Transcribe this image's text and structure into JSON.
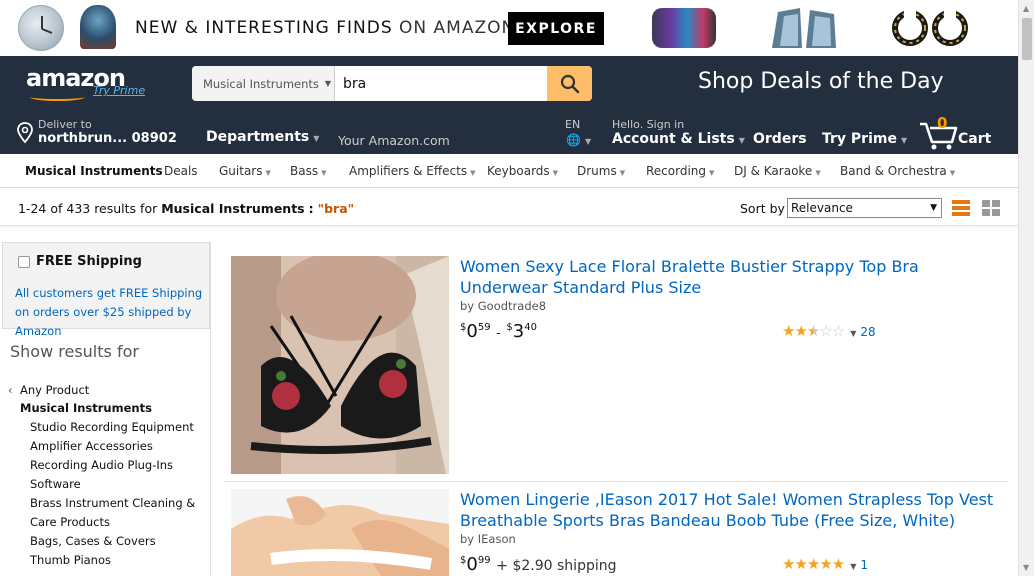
{
  "promo": {
    "headline_bold": "NEW & INTERESTING FINDS",
    "headline_light": "ON AMAZON",
    "cta": "EXPLORE"
  },
  "header": {
    "logo": "amazon",
    "try_prime_logo": "Try Prime",
    "search": {
      "category": "Musical Instruments",
      "query": "bra"
    },
    "shop_deals": "Shop Deals of the Day",
    "deliver_to_label": "Deliver to",
    "deliver_to_location": "northbrun... 08902",
    "departments": "Departments",
    "your_amazon": "Your Amazon.com",
    "language": "EN",
    "hello_signin": "Hello. Sign in",
    "account_lists": "Account & Lists",
    "orders": "Orders",
    "try_prime": "Try Prime",
    "cart_count": "0",
    "cart_label": "Cart"
  },
  "subnav": {
    "items": [
      {
        "label": "Musical Instruments",
        "active": true
      },
      {
        "label": "Deals"
      },
      {
        "label": "Guitars"
      },
      {
        "label": "Bass"
      },
      {
        "label": "Amplifiers & Effects"
      },
      {
        "label": "Keyboards"
      },
      {
        "label": "Drums"
      },
      {
        "label": "Recording"
      },
      {
        "label": "DJ & Karaoke"
      },
      {
        "label": "Band & Orchestra"
      }
    ]
  },
  "results_bar": {
    "range": "1-24 of 433 results for",
    "category": "Musical Instruments",
    "colon": ":",
    "query": "\"bra\"",
    "sort_label": "Sort by",
    "sort_value": "Relevance"
  },
  "sidebar": {
    "free_shipping_label": "FREE Shipping",
    "free_shipping_note": "All customers get FREE Shipping on orders over $25 shipped by Amazon",
    "show_results_for": "Show results for",
    "any_product": "Any Product",
    "current_category": "Musical Instruments",
    "lines": [
      "Studio Recording Equipment",
      "Amplifier Accessories",
      "Recording Audio Plug-Ins",
      "Software",
      "Brass Instrument Cleaning &",
      "Care Products",
      "Bags, Cases & Covers",
      "Thumb Pianos"
    ]
  },
  "results": [
    {
      "title": "Women Sexy Lace Floral Bralette Bustier Strappy Top Bra Underwear Standard Plus Size",
      "by": "by Goodtrade8",
      "price_low_whole": "0",
      "price_low_frac": "59",
      "price_sep": "-",
      "price_high_whole": "3",
      "price_high_frac": "40",
      "currency": "$",
      "rating_stars": 2.5,
      "review_count": "28"
    },
    {
      "title": "Women Lingerie ,IEason 2017 Hot Sale! Women Strapless Top Vest Breathable Sports Bras Bandeau Boob Tube (Free Size, White)",
      "by": "by IEason",
      "price_whole": "0",
      "price_frac": "99",
      "currency": "$",
      "shipping": "+ $2.90 shipping",
      "rating_stars": 5,
      "review_count": "1"
    }
  ]
}
